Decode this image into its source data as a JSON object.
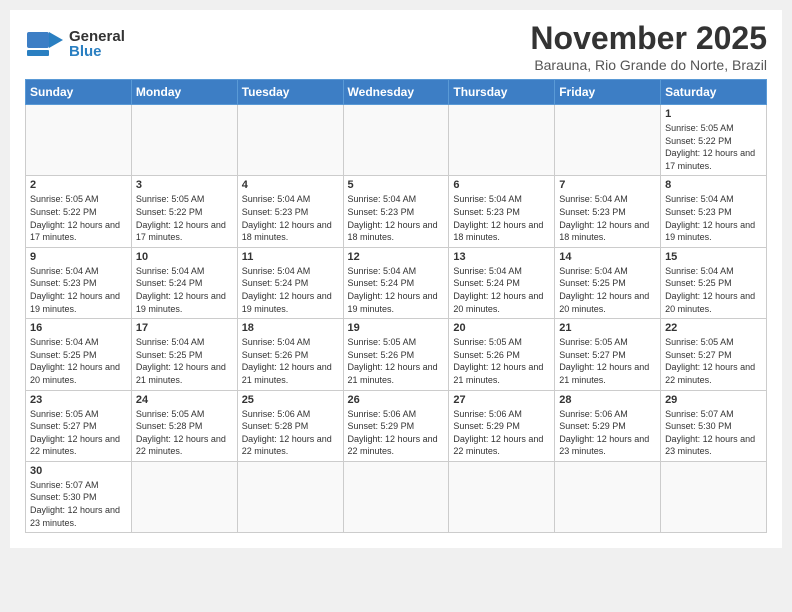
{
  "logo": {
    "general": "General",
    "blue": "Blue"
  },
  "header": {
    "month": "November 2025",
    "location": "Barauna, Rio Grande do Norte, Brazil"
  },
  "weekdays": [
    "Sunday",
    "Monday",
    "Tuesday",
    "Wednesday",
    "Thursday",
    "Friday",
    "Saturday"
  ],
  "weeks": [
    [
      {
        "num": "",
        "info": ""
      },
      {
        "num": "",
        "info": ""
      },
      {
        "num": "",
        "info": ""
      },
      {
        "num": "",
        "info": ""
      },
      {
        "num": "",
        "info": ""
      },
      {
        "num": "",
        "info": ""
      },
      {
        "num": "1",
        "info": "Sunrise: 5:05 AM\nSunset: 5:22 PM\nDaylight: 12 hours and 17 minutes."
      }
    ],
    [
      {
        "num": "2",
        "info": "Sunrise: 5:05 AM\nSunset: 5:22 PM\nDaylight: 12 hours and 17 minutes."
      },
      {
        "num": "3",
        "info": "Sunrise: 5:05 AM\nSunset: 5:22 PM\nDaylight: 12 hours and 17 minutes."
      },
      {
        "num": "4",
        "info": "Sunrise: 5:04 AM\nSunset: 5:23 PM\nDaylight: 12 hours and 18 minutes."
      },
      {
        "num": "5",
        "info": "Sunrise: 5:04 AM\nSunset: 5:23 PM\nDaylight: 12 hours and 18 minutes."
      },
      {
        "num": "6",
        "info": "Sunrise: 5:04 AM\nSunset: 5:23 PM\nDaylight: 12 hours and 18 minutes."
      },
      {
        "num": "7",
        "info": "Sunrise: 5:04 AM\nSunset: 5:23 PM\nDaylight: 12 hours and 18 minutes."
      },
      {
        "num": "8",
        "info": "Sunrise: 5:04 AM\nSunset: 5:23 PM\nDaylight: 12 hours and 19 minutes."
      }
    ],
    [
      {
        "num": "9",
        "info": "Sunrise: 5:04 AM\nSunset: 5:23 PM\nDaylight: 12 hours and 19 minutes."
      },
      {
        "num": "10",
        "info": "Sunrise: 5:04 AM\nSunset: 5:24 PM\nDaylight: 12 hours and 19 minutes."
      },
      {
        "num": "11",
        "info": "Sunrise: 5:04 AM\nSunset: 5:24 PM\nDaylight: 12 hours and 19 minutes."
      },
      {
        "num": "12",
        "info": "Sunrise: 5:04 AM\nSunset: 5:24 PM\nDaylight: 12 hours and 19 minutes."
      },
      {
        "num": "13",
        "info": "Sunrise: 5:04 AM\nSunset: 5:24 PM\nDaylight: 12 hours and 20 minutes."
      },
      {
        "num": "14",
        "info": "Sunrise: 5:04 AM\nSunset: 5:25 PM\nDaylight: 12 hours and 20 minutes."
      },
      {
        "num": "15",
        "info": "Sunrise: 5:04 AM\nSunset: 5:25 PM\nDaylight: 12 hours and 20 minutes."
      }
    ],
    [
      {
        "num": "16",
        "info": "Sunrise: 5:04 AM\nSunset: 5:25 PM\nDaylight: 12 hours and 20 minutes."
      },
      {
        "num": "17",
        "info": "Sunrise: 5:04 AM\nSunset: 5:25 PM\nDaylight: 12 hours and 21 minutes."
      },
      {
        "num": "18",
        "info": "Sunrise: 5:04 AM\nSunset: 5:26 PM\nDaylight: 12 hours and 21 minutes."
      },
      {
        "num": "19",
        "info": "Sunrise: 5:05 AM\nSunset: 5:26 PM\nDaylight: 12 hours and 21 minutes."
      },
      {
        "num": "20",
        "info": "Sunrise: 5:05 AM\nSunset: 5:26 PM\nDaylight: 12 hours and 21 minutes."
      },
      {
        "num": "21",
        "info": "Sunrise: 5:05 AM\nSunset: 5:27 PM\nDaylight: 12 hours and 21 minutes."
      },
      {
        "num": "22",
        "info": "Sunrise: 5:05 AM\nSunset: 5:27 PM\nDaylight: 12 hours and 22 minutes."
      }
    ],
    [
      {
        "num": "23",
        "info": "Sunrise: 5:05 AM\nSunset: 5:27 PM\nDaylight: 12 hours and 22 minutes."
      },
      {
        "num": "24",
        "info": "Sunrise: 5:05 AM\nSunset: 5:28 PM\nDaylight: 12 hours and 22 minutes."
      },
      {
        "num": "25",
        "info": "Sunrise: 5:06 AM\nSunset: 5:28 PM\nDaylight: 12 hours and 22 minutes."
      },
      {
        "num": "26",
        "info": "Sunrise: 5:06 AM\nSunset: 5:29 PM\nDaylight: 12 hours and 22 minutes."
      },
      {
        "num": "27",
        "info": "Sunrise: 5:06 AM\nSunset: 5:29 PM\nDaylight: 12 hours and 22 minutes."
      },
      {
        "num": "28",
        "info": "Sunrise: 5:06 AM\nSunset: 5:29 PM\nDaylight: 12 hours and 23 minutes."
      },
      {
        "num": "29",
        "info": "Sunrise: 5:07 AM\nSunset: 5:30 PM\nDaylight: 12 hours and 23 minutes."
      }
    ],
    [
      {
        "num": "30",
        "info": "Sunrise: 5:07 AM\nSunset: 5:30 PM\nDaylight: 12 hours and 23 minutes."
      },
      {
        "num": "",
        "info": ""
      },
      {
        "num": "",
        "info": ""
      },
      {
        "num": "",
        "info": ""
      },
      {
        "num": "",
        "info": ""
      },
      {
        "num": "",
        "info": ""
      },
      {
        "num": "",
        "info": ""
      }
    ]
  ]
}
